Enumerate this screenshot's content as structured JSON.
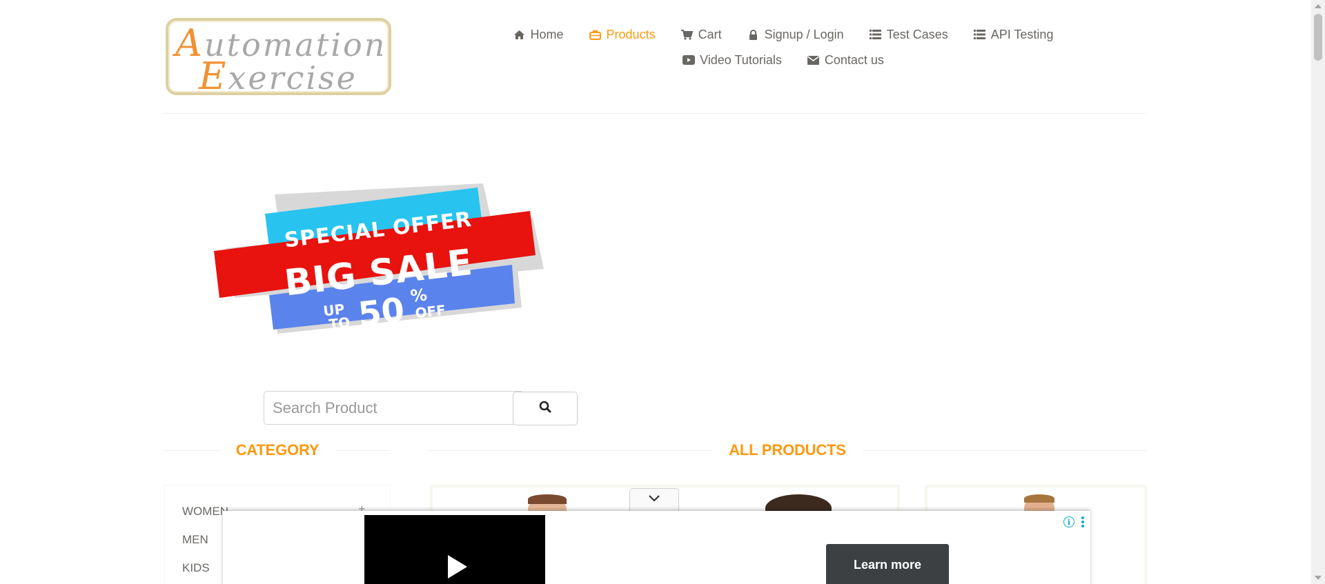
{
  "logo": {
    "line1_cap": "A",
    "line1_rest": "utomation",
    "line2_cap": "E",
    "line2_rest": "xercise"
  },
  "nav": {
    "items": [
      {
        "label": "Home",
        "icon": "home-icon",
        "active": false
      },
      {
        "label": "Products",
        "icon": "briefcase-icon",
        "active": true
      },
      {
        "label": "Cart",
        "icon": "cart-icon",
        "active": false
      },
      {
        "label": "Signup / Login",
        "icon": "lock-icon",
        "active": false
      },
      {
        "label": "Test Cases",
        "icon": "list-icon",
        "active": false
      },
      {
        "label": "API Testing",
        "icon": "list-icon",
        "active": false
      },
      {
        "label": "Video Tutorials",
        "icon": "youtube-play-icon",
        "active": false
      },
      {
        "label": "Contact us",
        "icon": "envelope-icon",
        "active": false
      }
    ]
  },
  "banner": {
    "line1": "SPECIAL OFFER",
    "line2": "BIG SALE",
    "up": "UP",
    "to": "TO",
    "number": "50",
    "percent": "%",
    "off": "OFF"
  },
  "search": {
    "placeholder": "Search Product",
    "value": "",
    "button_icon": "search-icon"
  },
  "sections": {
    "category_title": "CATEGORY",
    "products_title": "ALL PRODUCTS"
  },
  "categories": [
    {
      "label": "Women",
      "expand": "+"
    },
    {
      "label": "Men",
      "expand": "+"
    },
    {
      "label": "Kids",
      "expand": "+"
    }
  ],
  "ad": {
    "learn_more": "Learn more",
    "info_icon": "i",
    "toggle_icon": "chevron-down-icon"
  },
  "colors": {
    "accent": "#fe980f",
    "text": "#696763",
    "logo_orange": "#f29132",
    "ad_button": "#3c4043",
    "ad_info": "#00aecd"
  }
}
